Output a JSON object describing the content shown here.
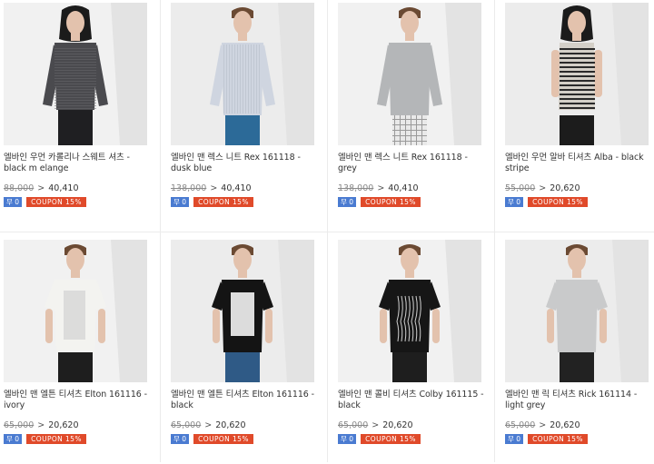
{
  "products": [
    {
      "name": "엘바인 우먼 카롤리나 스웨트 셔츠 - black m elange",
      "old_price": "88,000",
      "new_price": "40,410",
      "badge_text": "무 0",
      "coupon_text": "COUPON 15%",
      "image": "woman in grey melange sweatshirt and black pants",
      "top_color": "#4a4a4e",
      "bottom_color": "#1f1f22"
    },
    {
      "name": "엘바인 맨 렉스 니트 Rex 161118 - dusk blue",
      "old_price": "138,000",
      "new_price": "40,410",
      "badge_text": "무 0",
      "coupon_text": "COUPON 15%",
      "image": "man in pale blue striped knit and blue pants",
      "top_color": "#cfd5e0",
      "bottom_color": "#2c6a98"
    },
    {
      "name": "엘바인 맨 렉스 니트 Rex 161118 - grey",
      "old_price": "138,000",
      "new_price": "40,410",
      "badge_text": "무 0",
      "coupon_text": "COUPON 15%",
      "image": "man in grey knit with checked pants",
      "top_color": "#b4b6b8",
      "bottom_color": "#e9e9e9"
    },
    {
      "name": "엘바인 우먼 알바 티셔츠 Alba - black stripe",
      "old_price": "55,000",
      "new_price": "20,620",
      "badge_text": "무 0",
      "coupon_text": "COUPON 15%",
      "image": "woman in black striped sleeveless top",
      "top_color": "#d4d0c8",
      "bottom_color": "#1c1c1c"
    },
    {
      "name": "엘바인 맨 엘튼 티셔츠 Elton 161116 - ivory",
      "old_price": "65,000",
      "new_price": "20,620",
      "badge_text": "무 0",
      "coupon_text": "COUPON 15%",
      "image": "man in ivory tee with silver print",
      "top_color": "#f3f3f0",
      "bottom_color": "#1e1e1e"
    },
    {
      "name": "엘바인 맨 엘튼 티셔츠 Elton 161116 - black",
      "old_price": "65,000",
      "new_price": "20,620",
      "badge_text": "무 0",
      "coupon_text": "COUPON 15%",
      "image": "man in black tee with silver panel and blue jeans",
      "top_color": "#141414",
      "bottom_color": "#2f5a86"
    },
    {
      "name": "엘바인 맨 콜비 티셔츠 Colby 161115 - black",
      "old_price": "65,000",
      "new_price": "20,620",
      "badge_text": "무 0",
      "coupon_text": "COUPON 15%",
      "image": "man in black tee with white line graphic",
      "top_color": "#161616",
      "bottom_color": "#1e1e1e"
    },
    {
      "name": "엘바인 맨 릭 티셔츠 Rick 161114 - light grey",
      "old_price": "65,000",
      "new_price": "20,620",
      "badge_text": "무 0",
      "coupon_text": "COUPON 15%",
      "image": "man in light grey tee and black shorts",
      "top_color": "#c9cacb",
      "bottom_color": "#222222"
    }
  ]
}
